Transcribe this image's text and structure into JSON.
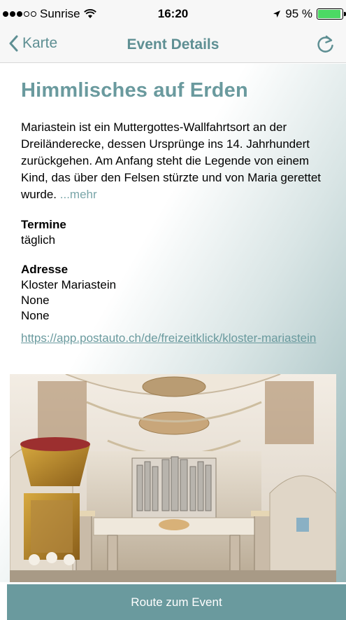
{
  "status_bar": {
    "carrier": "Sunrise",
    "time": "16:20",
    "battery_percent_label": "95 %",
    "battery_level": 0.95,
    "signal_bars_filled": 3,
    "signal_bars_total": 5
  },
  "nav": {
    "back_label": "Karte",
    "title": "Event Details",
    "icons": {
      "back": "chevron-left-icon",
      "refresh": "refresh-icon"
    },
    "accent_color": "#5e8f93"
  },
  "event": {
    "title": "Himmlisches auf Erden",
    "description": "Mariastein ist ein Muttergottes-Wallfahrtsort an der Dreiländerecke, dessen Ursprünge ins 14. Jahrhundert zurückgehen. Am Anfang steht die Legende von einem Kind, das über den Felsen stürzte und von Maria gerettet wurde.",
    "more_label": "...mehr",
    "dates_label": "Termine",
    "dates_value": "täglich",
    "address_label": "Adresse",
    "address_lines": [
      "Kloster Mariastein",
      "None",
      "None"
    ],
    "url": "https://app.postauto.ch/de/freizeitklick/kloster-mariastein"
  },
  "route_button": {
    "label": "Route zum Event",
    "color": "#6a9a9e"
  }
}
